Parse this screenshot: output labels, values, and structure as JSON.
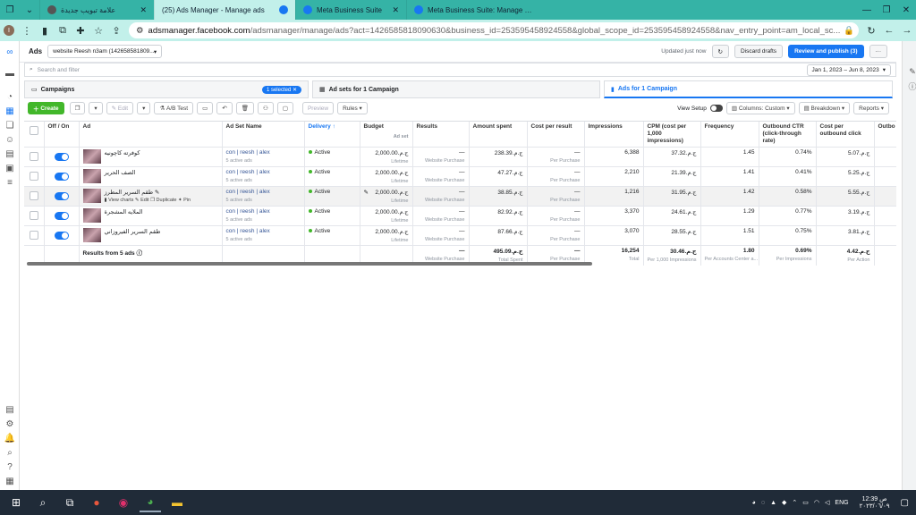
{
  "browser": {
    "tabs": [
      {
        "title": "علامة تبويب جديدة",
        "active": false
      },
      {
        "title": "(25) Ads Manager - Manage ads",
        "active": true
      },
      {
        "title": "Meta Business Suite",
        "active": false
      },
      {
        "title": "Meta Business Suite: Manage Fac",
        "active": false
      }
    ],
    "url_host": "adsmanager.facebook.com",
    "url_path": "/adsmanager/manage/ads?act=1426585818090630&business_id=253595458924558&global_scope_id=253595458924558&nav_entry_point=am_local_sc...",
    "accent": "#35b3a6"
  },
  "header": {
    "section": "Ads",
    "account": "website Reesh n3am (142658581809...",
    "updated": "Updated just now",
    "discard": "Discard drafts",
    "review": "Review and publish (3)",
    "more": "···"
  },
  "search": {
    "placeholder": "Search and filter",
    "date_range": "Jan 1, 2023 – Jun 8, 2023"
  },
  "levels": {
    "campaigns": "Campaigns",
    "selected": "1 selected",
    "adsets": "Ad sets for 1 Campaign",
    "ads": "Ads for 1 Campaign"
  },
  "toolbar": {
    "create": "Create",
    "edit": "Edit",
    "ab": "A/B Test",
    "preview": "Preview",
    "rules": "Rules",
    "view_setup": "View Setup",
    "columns": "Columns: Custom",
    "breakdown": "Breakdown",
    "reports": "Reports"
  },
  "table": {
    "headers": [
      "Off / On",
      "Ad",
      "Ad Set Name",
      "Delivery ↑",
      "Budget",
      "Results",
      "Amount spent",
      "Cost per result",
      "Impressions",
      "CPM (cost per 1,000 impressions)",
      "Frequency",
      "Outbound CTR (click-through rate)",
      "Cost per outbound click",
      "Outbo"
    ],
    "budget_sub": "Ad set",
    "rows": [
      {
        "ad": "كوفرته كاچونيه",
        "adset": "con | reesh | alex",
        "adset_sub": "5 active ads",
        "delivery": "Active",
        "budget": "ج.م.‏2,000.00",
        "budget_sub": "Lifetime",
        "results": "—",
        "results_sub": "Website Purchase",
        "spent": "ج.م.‏238.39",
        "cpr": "—",
        "cpr_sub": "Per Purchase",
        "impr": "6,388",
        "cpm": "ج.م.‏37.32",
        "freq": "1.45",
        "ctr": "0.74%",
        "cpoc": "ج.م.‏5.07"
      },
      {
        "ad": "الصف الحرير",
        "adset": "con | reesh | alex",
        "adset_sub": "5 active ads",
        "delivery": "Active",
        "budget": "ج.م.‏2,000.00",
        "budget_sub": "Lifetime",
        "results": "—",
        "results_sub": "Website Purchase",
        "spent": "ج.م.‏47.27",
        "cpr": "—",
        "cpr_sub": "Per Purchase",
        "impr": "2,210",
        "cpm": "ج.م.‏21.39",
        "freq": "1.41",
        "ctr": "0.41%",
        "cpoc": "ج.م.‏5.25"
      },
      {
        "ad": "طقم السرير المطرز",
        "adset": "con | reesh | alex",
        "adset_sub": "5 active ads",
        "delivery": "Active",
        "budget": "ج.م.‏2,000.00",
        "budget_sub": "Lifetime",
        "results": "—",
        "results_sub": "Website Purchase",
        "spent": "ج.م.‏38.85",
        "cpr": "—",
        "cpr_sub": "Per Purchase",
        "impr": "1,216",
        "cpm": "ج.م.‏31.95",
        "freq": "1.42",
        "ctr": "0.58%",
        "cpoc": "ج.م.‏5.55",
        "actions": [
          "View charts",
          "Edit",
          "Duplicate",
          "Pin"
        ]
      },
      {
        "ad": "الملايه المشجرة",
        "adset": "con | reesh | alex",
        "adset_sub": "5 active ads",
        "delivery": "Active",
        "budget": "ج.م.‏2,000.00",
        "budget_sub": "Lifetime",
        "results": "—",
        "results_sub": "Website Purchase",
        "spent": "ج.م.‏82.92",
        "cpr": "—",
        "cpr_sub": "Per Purchase",
        "impr": "3,370",
        "cpm": "ج.م.‏24.61",
        "freq": "1.29",
        "ctr": "0.77%",
        "cpoc": "ج.م.‏3.19"
      },
      {
        "ad": "طقم السرير الفيروزاني",
        "adset": "con | reesh | alex",
        "adset_sub": "5 active ads",
        "delivery": "Active",
        "budget": "ج.م.‏2,000.00",
        "budget_sub": "Lifetime",
        "results": "—",
        "results_sub": "Website Purchase",
        "spent": "ج.م.‏87.66",
        "cpr": "—",
        "cpr_sub": "Per Purchase",
        "impr": "3,070",
        "cpm": "ج.م.‏28.55",
        "freq": "1.51",
        "ctr": "0.75%",
        "cpoc": "ج.م.‏3.81"
      }
    ],
    "total": {
      "label": "Results from 5 ads",
      "results": "—",
      "results_sub": "Website Purchase",
      "spent": "ج.م.‏495.09",
      "spent_sub": "Total Spent",
      "cpr": "—",
      "cpr_sub": "Per Purchase",
      "impr": "16,254",
      "impr_sub": "Total",
      "cpm": "ج.م.‏30.46",
      "cpm_sub": "Per 1,000 Impressions",
      "freq": "1.80",
      "freq_sub": "Per Accounts Center a...",
      "ctr": "0.69%",
      "ctr_sub": "Per Impressions",
      "cpoc": "ج.م.‏4.42",
      "cpoc_sub": "Per Action"
    }
  },
  "taskbar": {
    "lang": "ENG",
    "time": "12:39 ص",
    "date": "٢٠٢٣/٠٦/٠٩"
  }
}
